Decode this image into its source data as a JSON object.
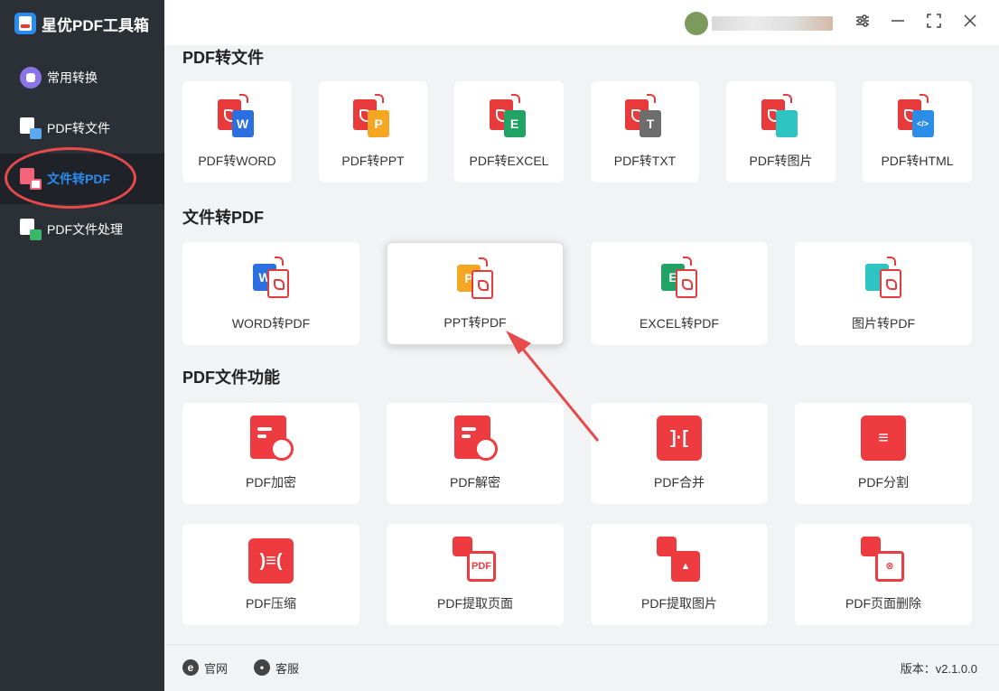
{
  "app": {
    "title": "星优PDF工具箱"
  },
  "sidebar": {
    "items": [
      {
        "label": "常用转换",
        "icon": "apps-icon"
      },
      {
        "label": "PDF转文件",
        "icon": "pdf-to-file-icon"
      },
      {
        "label": "文件转PDF",
        "icon": "file-to-pdf-icon",
        "active": true
      },
      {
        "label": "PDF文件处理",
        "icon": "pdf-process-icon"
      }
    ]
  },
  "window": {
    "buttons": [
      "settings-icon",
      "minimize-icon",
      "maximize-icon",
      "close-icon"
    ]
  },
  "sections": {
    "pdf_to_file": {
      "title": "PDF转文件",
      "items": [
        {
          "label": "PDF转WORD",
          "badge": "W",
          "color": "#2b6fe0"
        },
        {
          "label": "PDF转PPT",
          "badge": "P",
          "color": "#f5a623"
        },
        {
          "label": "PDF转EXCEL",
          "badge": "E",
          "color": "#21a366"
        },
        {
          "label": "PDF转TXT",
          "badge": "T",
          "color": "#6d6d6d"
        },
        {
          "label": "PDF转图片",
          "badge": "",
          "color": "#2ec4c4"
        },
        {
          "label": "PDF转HTML",
          "badge": "</>",
          "color": "#2b8de8"
        }
      ]
    },
    "file_to_pdf": {
      "title": "文件转PDF",
      "items": [
        {
          "label": "WORD转PDF",
          "badge": "W",
          "color": "#2b6fe0"
        },
        {
          "label": "PPT转PDF",
          "badge": "P",
          "color": "#f5a623"
        },
        {
          "label": "EXCEL转PDF",
          "badge": "E",
          "color": "#21a366"
        },
        {
          "label": "图片转PDF",
          "badge": "",
          "color": "#2ec4c4"
        }
      ]
    },
    "pdf_functions": {
      "title": "PDF文件功能",
      "items": [
        {
          "label": "PDF加密",
          "icon": "lock-icon"
        },
        {
          "label": "PDF解密",
          "icon": "key-icon"
        },
        {
          "label": "PDF合并",
          "icon": "merge-icon"
        },
        {
          "label": "PDF分割",
          "icon": "split-icon"
        },
        {
          "label": "PDF压缩",
          "icon": "compress-icon"
        },
        {
          "label": "PDF提取页面",
          "icon": "extract-page-icon"
        },
        {
          "label": "PDF提取图片",
          "icon": "extract-image-icon"
        },
        {
          "label": "PDF页面删除",
          "icon": "delete-page-icon"
        }
      ]
    }
  },
  "footer": {
    "website": "官网",
    "service": "客服",
    "version": "版本：v2.1.0.0"
  },
  "colors": {
    "accent": "#2a8cf0",
    "red": "#ee3b3f",
    "sidebar": "#2b2f36"
  }
}
